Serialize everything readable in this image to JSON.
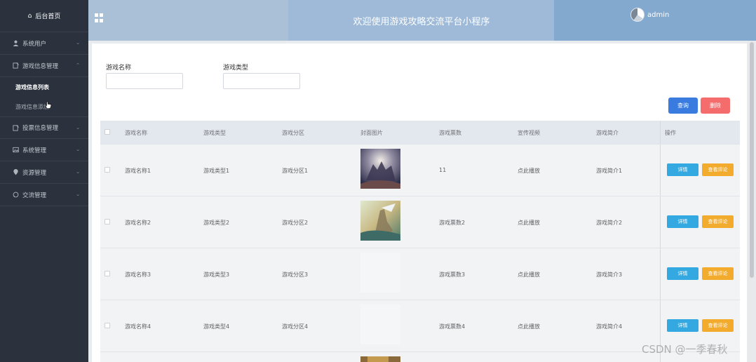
{
  "sidebar": {
    "home": "后台首页",
    "menus": [
      {
        "label": "系统用户",
        "icon": "user-icon",
        "chevron": "⌄"
      },
      {
        "label": "游戏信息管理",
        "icon": "file-icon",
        "chevron": "⌃"
      },
      {
        "label": "投票信息管理",
        "icon": "file-icon",
        "chevron": "⌄"
      },
      {
        "label": "系统管理",
        "icon": "picture-icon",
        "chevron": "⌄"
      },
      {
        "label": "资源管理",
        "icon": "location-icon",
        "chevron": "⌄"
      },
      {
        "label": "交流管理",
        "icon": "chat-icon",
        "chevron": "⌄"
      }
    ],
    "submenu": [
      "游戏信息列表",
      "游戏信息添加"
    ]
  },
  "header": {
    "title": "欢迎使用游戏攻略交流平台小程序",
    "username": "admin"
  },
  "search": {
    "name_label": "游戏名称",
    "type_label": "游戏类型",
    "query_button": "查询",
    "delete_button": "删除"
  },
  "table": {
    "columns": [
      "游戏名称",
      "游戏类型",
      "游戏分区",
      "封面图片",
      "游戏票数",
      "宣传视频",
      "游戏简介",
      "操作"
    ],
    "rows": [
      {
        "name": "游戏名称1",
        "type": "游戏类型1",
        "zone": "游戏分区1",
        "votes": "11",
        "video": "点此播放",
        "intro": "游戏简介1",
        "cover": "art1"
      },
      {
        "name": "游戏名称2",
        "type": "游戏类型2",
        "zone": "游戏分区2",
        "votes": "游戏票数2",
        "video": "点此播放",
        "intro": "游戏简介2",
        "cover": "art2"
      },
      {
        "name": "游戏名称3",
        "type": "游戏类型3",
        "zone": "游戏分区3",
        "votes": "游戏票数3",
        "video": "点此播放",
        "intro": "游戏简介3",
        "cover": "empty"
      },
      {
        "name": "游戏名称4",
        "type": "游戏类型4",
        "zone": "游戏分区4",
        "votes": "游戏票数4",
        "video": "点此播放",
        "intro": "游戏简介4",
        "cover": "empty"
      }
    ],
    "detail_button": "详情",
    "comment_button": "查看评论"
  },
  "colors": {
    "sidebar_bg": "#2b323d",
    "header_bg": "#a9c0d7",
    "query": "#3a7be0",
    "delete": "#f56c6c",
    "detail": "#34a9e1",
    "comment": "#f3ab2e"
  },
  "watermark": "CSDN @一季春秋"
}
